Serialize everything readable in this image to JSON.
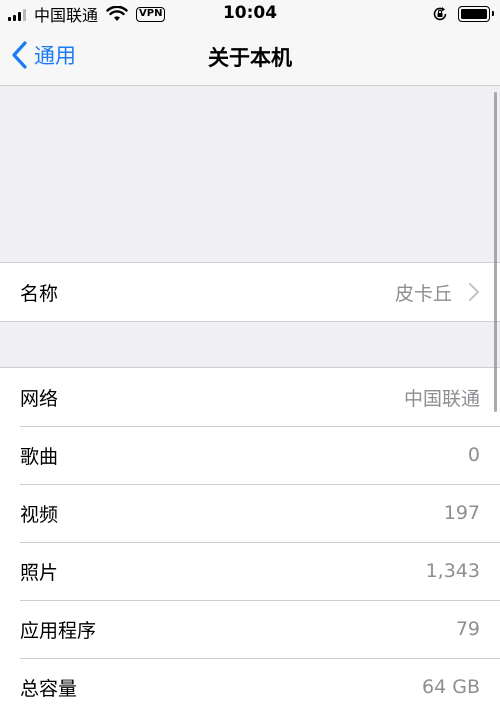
{
  "status_bar": {
    "carrier": "中国联通",
    "vpn": "VPN",
    "time": "10:04"
  },
  "nav": {
    "back_label": "通用",
    "title": "关于本机"
  },
  "name_row": {
    "label": "名称",
    "value": "皮卡丘"
  },
  "info_rows": [
    {
      "label": "网络",
      "value": "中国联通"
    },
    {
      "label": "歌曲",
      "value": "0"
    },
    {
      "label": "视频",
      "value": "197"
    },
    {
      "label": "照片",
      "value": "1,343"
    },
    {
      "label": "应用程序",
      "value": "79"
    },
    {
      "label": "总容量",
      "value": "64 GB"
    }
  ],
  "colors": {
    "accent": "#1a7cf5",
    "secondary_text": "#8e8e93",
    "background": "#efeff4"
  },
  "icons": [
    "signal-icon",
    "wifi-icon",
    "vpn-badge",
    "rotation-lock-icon",
    "battery-icon",
    "chevron-left-icon",
    "chevron-right-icon"
  ]
}
